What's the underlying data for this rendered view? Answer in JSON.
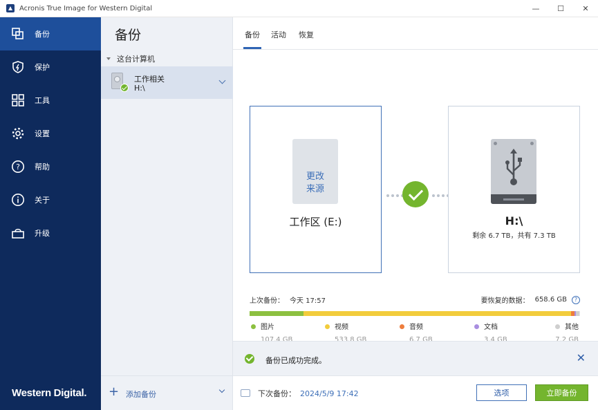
{
  "window": {
    "title": "Acronis True Image for Western Digital",
    "controls": [
      "—",
      "☐",
      "✕"
    ]
  },
  "sidebar": {
    "items": [
      {
        "label": "备份",
        "icon": "backup-icon",
        "active": true
      },
      {
        "label": "保护",
        "icon": "shield-icon",
        "active": false
      },
      {
        "label": "工具",
        "icon": "tools-grid-icon",
        "active": false
      },
      {
        "label": "设置",
        "icon": "gear-icon",
        "active": false
      },
      {
        "label": "帮助",
        "icon": "help-icon",
        "active": false
      },
      {
        "label": "关于",
        "icon": "info-icon",
        "active": false
      },
      {
        "label": "升级",
        "icon": "basket-icon",
        "active": false
      }
    ],
    "brand": "Western Digital."
  },
  "midpanel": {
    "title": "备份",
    "group": "这台计算机",
    "plan": {
      "name": "工作相关",
      "destination": "H:\\"
    },
    "add_label": "添加备份"
  },
  "tabs": [
    {
      "label": "备份",
      "active": true
    },
    {
      "label": "活动",
      "active": false
    },
    {
      "label": "恢复",
      "active": false
    }
  ],
  "source": {
    "change_line1": "更改",
    "change_line2": "来源",
    "label": "工作区 (E:)"
  },
  "destination": {
    "label": "H:\\",
    "sub": "剩余 6.7 TB，共有 7.3 TB"
  },
  "summary": {
    "last_backup_label": "上次备份：",
    "last_backup_value": "今天 17:57",
    "recover_label": "要恢复的数据：",
    "recover_value": "658.6 GB"
  },
  "usage": [
    {
      "label": "图片",
      "size": "107.4 GB",
      "color": "#8cc040",
      "fraction": 0.163
    },
    {
      "label": "视频",
      "size": "533.8 GB",
      "color": "#f2cc3c",
      "fraction": 0.81
    },
    {
      "label": "音频",
      "size": "6.7 GB",
      "color": "#ee7d3d",
      "fraction": 0.01
    },
    {
      "label": "文档",
      "size": "3.4 GB",
      "color": "#a98ee0",
      "fraction": 0.005
    },
    {
      "label": "其他",
      "size": "7.2 GB",
      "color": "#cfcfcf",
      "fraction": 0.011
    }
  ],
  "banner": {
    "text": "备份已成功完成。",
    "close": "✕"
  },
  "footer": {
    "next_backup_label": "下次备份：",
    "next_backup_value": "2024/5/9 17:42",
    "options_label": "选项",
    "backup_now_label": "立即备份"
  }
}
